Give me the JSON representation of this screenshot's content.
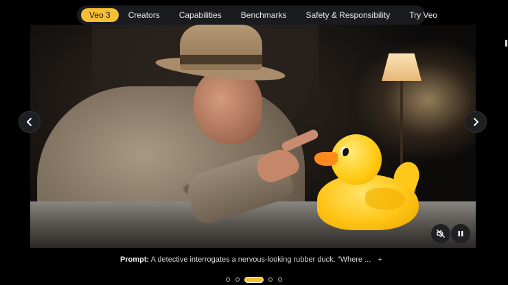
{
  "nav": {
    "items": [
      {
        "label": "Veo 3",
        "active": true
      },
      {
        "label": "Creators",
        "active": false
      },
      {
        "label": "Capabilities",
        "active": false
      },
      {
        "label": "Benchmarks",
        "active": false
      },
      {
        "label": "Safety & Responsibility",
        "active": false
      },
      {
        "label": "Try Veo",
        "active": false
      }
    ]
  },
  "carousel": {
    "prev_icon": "chevron-left-icon",
    "next_icon": "chevron-right-icon",
    "slide_count": 5,
    "active_slide": 3
  },
  "video_controls": {
    "mute_icon": "volume-off-icon",
    "pause_icon": "pause-icon"
  },
  "caption": {
    "label": "Prompt:",
    "text": " A detective interrogates a nervous-looking rubber duck. \"Where ...",
    "expand": "+"
  },
  "colors": {
    "accent": "#f5bf34",
    "nav_bg": "#1a1b1f",
    "page_bg": "#000000"
  }
}
